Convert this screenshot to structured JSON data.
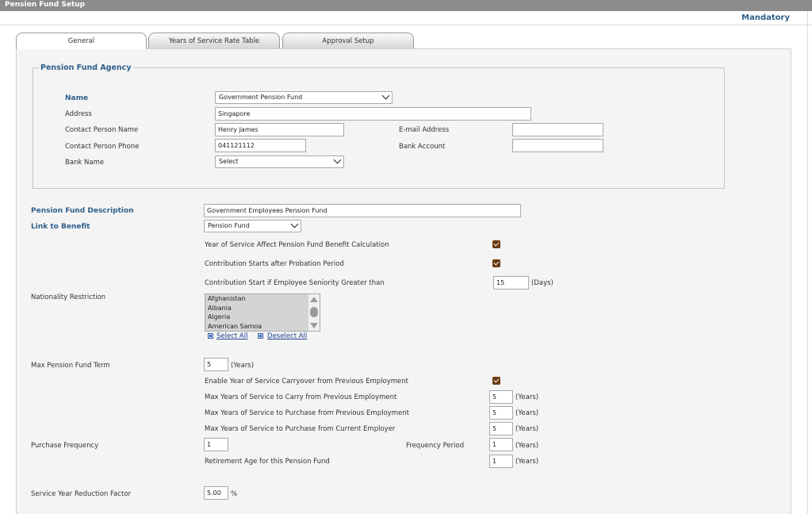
{
  "title": "Pension Fund Setup",
  "mandatory": "Mandatory",
  "tabs": [
    {
      "label": "General"
    },
    {
      "label": "Years of Service Rate Table"
    },
    {
      "label": "Approval Setup"
    }
  ],
  "agency": {
    "legend": "Pension Fund Agency",
    "name_label": "Name",
    "name_value": "Government Pension Fund",
    "address_label": "Address",
    "address_value": "Singapore",
    "contact_name_label": "Contact Person Name",
    "contact_name_value": "Henry James",
    "email_label": "E-mail Address",
    "email_value": "",
    "contact_phone_label": "Contact Person Phone",
    "contact_phone_value": "041121112",
    "bank_account_label": "Bank Account",
    "bank_account_value": "",
    "bank_name_label": "Bank Name",
    "bank_name_value": "Select"
  },
  "description_label": "Pension Fund Description",
  "description_value": "Government Employees Pension Fund",
  "link_benefit_label": "Link to Benefit",
  "link_benefit_value": "Pension Fund",
  "yos_affect_label": "Year of Service Affect Pension Fund Benefit Calculation",
  "yos_affect_checked": true,
  "contrib_probation_label": "Contribution Starts after Probation Period",
  "contrib_probation_checked": true,
  "contrib_seniority_label": "Contribution Start if Employee Seniority Greater than",
  "contrib_seniority_value": "15",
  "days_unit": "(Days)",
  "nationality_label": "Nationality Restriction",
  "nationality_options": [
    "Afghanistan",
    "Albania",
    "Algeria",
    "American Samoa"
  ],
  "select_all": "Select All",
  "deselect_all": "Deselect All",
  "max_term_label": "Max Pension Fund Term",
  "max_term_value": "5",
  "years_unit": "(Years)",
  "carryover_label": "Enable Year of Service Carryover from Previous Employment",
  "carryover_checked": true,
  "max_carry_label": "Max Years of Service to Carry from Previous Employment",
  "max_carry_value": "5",
  "max_purchase_prev_label": "Max Years of Service to Purchase from Previous Employment",
  "max_purchase_prev_value": "5",
  "max_purchase_curr_label": "Max Years of Service to Purchase from Current Employer",
  "max_purchase_curr_value": "5",
  "purchase_freq_label": "Purchase Frequency",
  "purchase_freq_value": "1",
  "freq_period_label": "Frequency Period",
  "freq_period_value": "1",
  "retirement_age_label": "Retirement Age for this Pension Fund",
  "retirement_age_value": "1",
  "reduction_factor_label": "Service Year Reduction Factor",
  "reduction_factor_value": "5.00",
  "percent_unit": "%",
  "colors": {
    "accent": "#2f5f8a",
    "checkbox": "#6b3a10",
    "titlebar": "#8c8c8c"
  }
}
